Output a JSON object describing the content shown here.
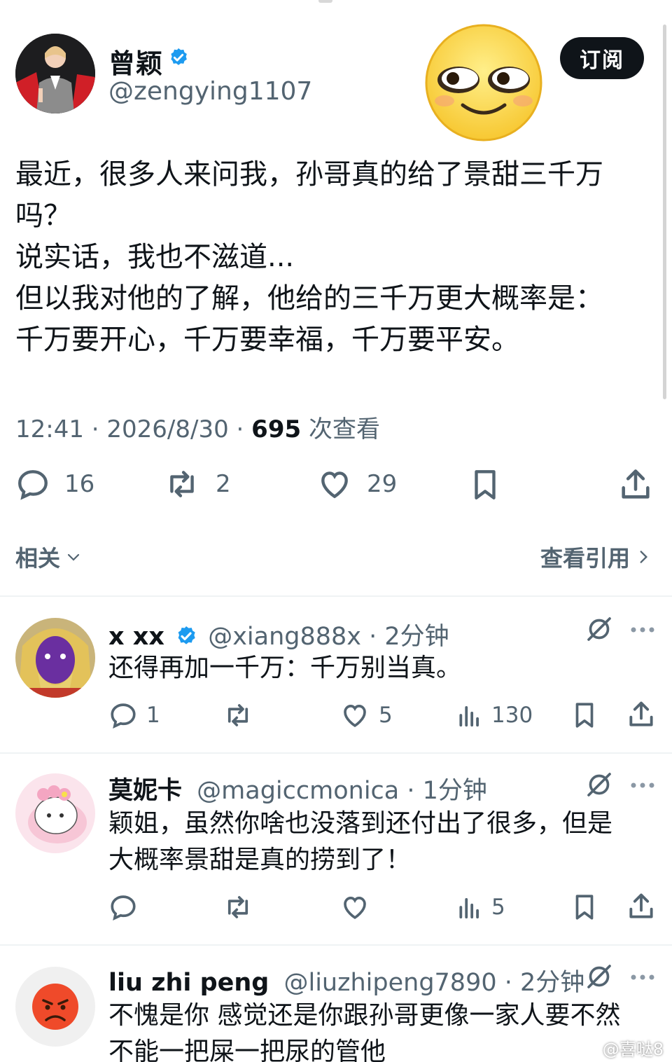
{
  "colors": {
    "text": "#0f1419",
    "muted": "#536471",
    "verified": "#1d9bf0",
    "subscribe_bg": "#0f1419"
  },
  "main_tweet": {
    "author_name": "曾颖",
    "author_handle": "@zengying1107",
    "subscribe_label": "订阅",
    "text": "最近，很多人来问我，孙哥真的给了景甜三千万\n吗？\n说实话，我也不滋道...\n但以我对他的了解，他给的三千万更大概率是：\n千万要开心，千万要幸福，千万要平安。",
    "time": "12:41 · 2026/8/30 · ",
    "views_count": "695",
    "views_label": " 次查看",
    "replies": "16",
    "reposts": "2",
    "likes": "29",
    "related_label": "相关",
    "view_quotes_label": "查看引用"
  },
  "replies": [
    {
      "name": "x xx",
      "handle": "@xiang888x · 2分钟",
      "text": "还得再加一千万：千万别当真。",
      "reply_count": "1",
      "like_count": "5",
      "view_count": "130"
    },
    {
      "name": "莫妮卡",
      "handle": "@magiccmonica · 1分钟",
      "text": "颖姐，虽然你啥也没落到还付出了很多，但是\n大概率景甜是真的捞到了！",
      "view_count": "5"
    },
    {
      "name": "liu zhi peng",
      "handle": "@liuzhipeng7890 · 2分钟",
      "text": "不愧是你 感觉还是你跟孙哥更像一家人要不然\n不能一把屎一把尿的管他"
    }
  ],
  "watermark": "@喜哒8"
}
